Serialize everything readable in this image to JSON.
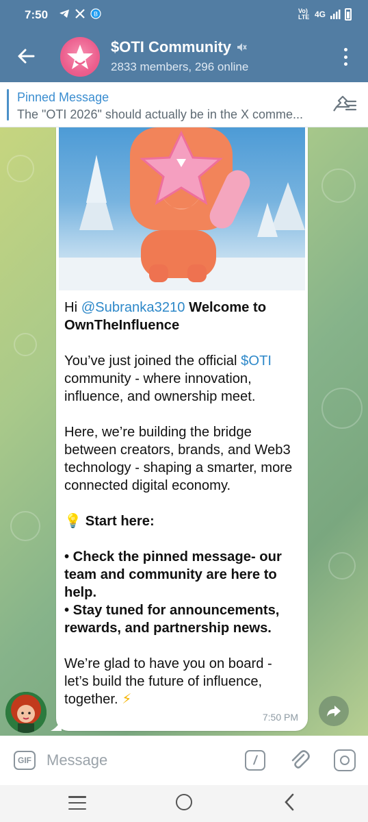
{
  "status_bar": {
    "time": "7:50",
    "network": "4G",
    "volte": "Vo) LTE"
  },
  "header": {
    "title": "$OTI Community",
    "subtitle": "2833 members, 296 online",
    "avatar_icon": "star-face-icon",
    "muted_icon": "mute-icon"
  },
  "pinned": {
    "title": "Pinned Message",
    "text": "The \"OTI 2026\" should actually be in the X comme..."
  },
  "message": {
    "greeting": "Hi ",
    "mention": "@Subranka3210",
    "welcome": " Welcome to OwnTheInfluence",
    "intro_1": "You’ve just joined the official ",
    "cashtag": "$OTI",
    "intro_2": " community - where innovation, influence, and ownership meet.",
    "para_2": "Here, we’re building the bridge between creators, brands, and Web3 technology - shaping a smarter, more connected digital economy.",
    "start_emoji": "💡",
    "start_label": " Start here:",
    "bullet_1": "• Check the pinned message- our team and community are here to help.",
    "bullet_2": "• Stay tuned for announcements, rewards, and partnership news.",
    "closing": "We’re glad to have you on board - let’s build the future of influence, together. ",
    "closing_emoji": "⚡",
    "time": "7:50 PM"
  },
  "input": {
    "placeholder": "Message",
    "gif_label": "GIF",
    "cmd_label": "/"
  },
  "colors": {
    "header_bg": "#527da3",
    "link": "#2d88c9",
    "pinned_title": "#3a8dd0"
  }
}
